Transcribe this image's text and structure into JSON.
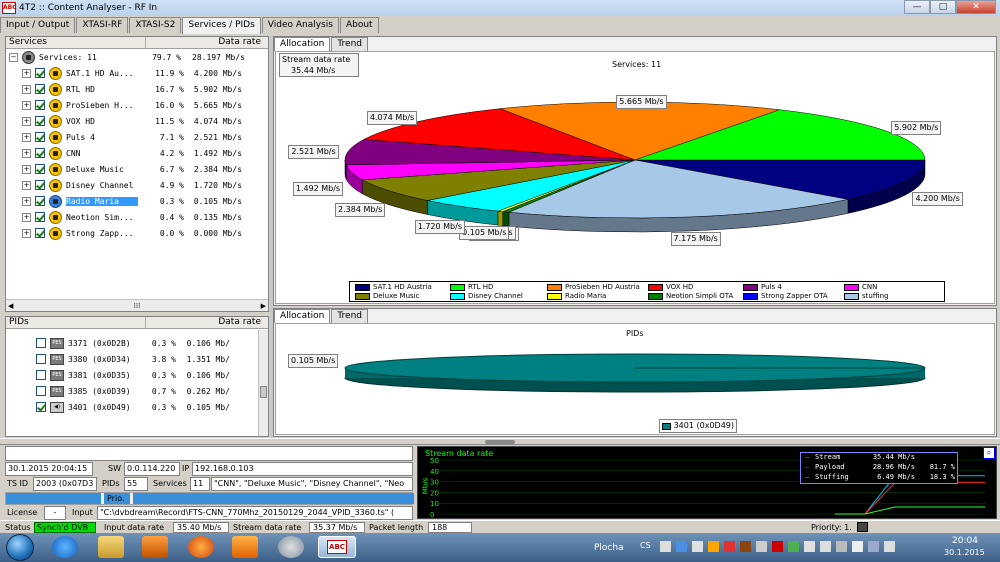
{
  "window": {
    "title": "4T2 :: Content Analyser - RF In",
    "app_badge": "ABC",
    "min": "—",
    "max": "□",
    "close": "✕"
  },
  "top_tabs": [
    "Input / Output",
    "XTASI-RF",
    "XTASI-S2",
    "Services / PIDs",
    "Video Analysis",
    "About"
  ],
  "services_panel": {
    "headers": [
      "Services",
      "Data rate"
    ],
    "root": {
      "label": "Services: 11",
      "pct": "79.7 %",
      "rate": "28.197 Mb/s"
    },
    "items": [
      {
        "name": "SAT.1 HD Au...",
        "pct": "11.9 %",
        "rate": "4.200 Mb/s"
      },
      {
        "name": "RTL HD",
        "pct": "16.7 %",
        "rate": "5.902 Mb/s"
      },
      {
        "name": "ProSieben H...",
        "pct": "16.0 %",
        "rate": "5.665 Mb/s"
      },
      {
        "name": "VOX HD",
        "pct": "11.5 %",
        "rate": "4.074 Mb/s"
      },
      {
        "name": "Puls 4",
        "pct": "7.1 %",
        "rate": "2.521 Mb/s"
      },
      {
        "name": "CNN",
        "pct": "4.2 %",
        "rate": "1.492 Mb/s"
      },
      {
        "name": "Deluxe Music",
        "pct": "6.7 %",
        "rate": "2.384 Mb/s"
      },
      {
        "name": "Disney Channel",
        "pct": "4.9 %",
        "rate": "1.720 Mb/s"
      },
      {
        "name": "Radio Maria",
        "pct": "0.3 %",
        "rate": "0.105 Mb/s",
        "selected": true
      },
      {
        "name": "Neotion Sim...",
        "pct": "0.4 %",
        "rate": "0.135 Mb/s"
      },
      {
        "name": "Strong Zapp...",
        "pct": "0.0 %",
        "rate": "0.000 Mb/s"
      }
    ]
  },
  "pids_panel": {
    "headers": [
      "PIDs",
      "Data rate"
    ],
    "items": [
      {
        "name": "3371 (0x0D2B)",
        "pct": "0.3 %",
        "rate": "0.106 Mb/",
        "checked": false
      },
      {
        "name": "3380 (0x0D34)",
        "pct": "3.8 %",
        "rate": "1.351 Mb/",
        "checked": false
      },
      {
        "name": "3381 (0x0D35)",
        "pct": "0.3 %",
        "rate": "0.106 Mb/",
        "checked": false
      },
      {
        "name": "3385 (0x0D39)",
        "pct": "0.7 %",
        "rate": "0.262 Mb/",
        "checked": false
      },
      {
        "name": "3401 (0x0D49)",
        "pct": "0.3 %",
        "rate": "0.105 Mb/",
        "checked": true
      }
    ],
    "pid_badge": "PES"
  },
  "chart_tabs": [
    "Allocation",
    "Trend"
  ],
  "stream_box": {
    "label": "Stream data rate",
    "value": "35.44 Mb/s"
  },
  "chart_data": [
    {
      "type": "pie",
      "title": "Services: 11",
      "unit": "Mb/s",
      "slices": [
        {
          "name": "SAT.1 HD Austria",
          "value": 4.2,
          "label": "4.200 Mb/s",
          "color": "#000080"
        },
        {
          "name": "stuffing",
          "value": 7.175,
          "label": "7.175 Mb/s",
          "color": "#a8c8e8"
        },
        {
          "name": "Strong Zapper OTA",
          "value": 0.0,
          "label": "0.000 Mb/s",
          "color": "#0000ff"
        },
        {
          "name": "Neotion Simpli OTA",
          "value": 0.135,
          "label": "0.135 Mb/s",
          "color": "#008000"
        },
        {
          "name": "Radio Maria",
          "value": 0.105,
          "label": "0.105 Mb/s",
          "color": "#ffff00"
        },
        {
          "name": "Disney Channel",
          "value": 1.72,
          "label": "1.720 Mb/s",
          "color": "#00ffff"
        },
        {
          "name": "Deluxe Music",
          "value": 2.384,
          "label": "2.384 Mb/s",
          "color": "#808000"
        },
        {
          "name": "CNN",
          "value": 1.492,
          "label": "1.492 Mb/s",
          "color": "#ff00ff"
        },
        {
          "name": "Puls 4",
          "value": 2.521,
          "label": "2.521 Mb/s",
          "color": "#800080"
        },
        {
          "name": "VOX HD",
          "value": 4.074,
          "label": "4.074 Mb/s",
          "color": "#ff0000"
        },
        {
          "name": "ProSieben HD Austria",
          "value": 5.665,
          "label": "5.665 Mb/s",
          "color": "#ff8000"
        },
        {
          "name": "RTL HD",
          "value": 5.902,
          "label": "5.902 Mb/s",
          "color": "#00ff00"
        }
      ],
      "legend": [
        "SAT.1 HD Austria",
        "RTL HD",
        "ProSieben HD Austria",
        "VOX HD",
        "Puls 4",
        "CNN",
        "Deluxe Music",
        "Disney Channel",
        "Radio Maria",
        "Neotion Simpli OTA",
        "Strong Zapper OTA",
        "stuffing"
      ]
    },
    {
      "type": "pie",
      "title": "PIDs",
      "unit": "Mb/s",
      "slices": [
        {
          "name": "3401 (0x0D49)",
          "value": 0.105,
          "label": "0.105 Mb/s",
          "color": "#008080"
        }
      ],
      "legend": [
        "3401 (0x0D49)"
      ]
    },
    {
      "type": "line",
      "title": "Stream data rate",
      "ylabel": "Mb/s",
      "yticks": [
        0,
        10,
        20,
        30,
        40,
        50
      ],
      "ylim": [
        0,
        50
      ],
      "series": [
        {
          "name": "Stream",
          "values": [
            0,
            0,
            35.44,
            35.44,
            35.44,
            35.44
          ],
          "color": "#00c0ff"
        },
        {
          "name": "Payload",
          "values": [
            0,
            0,
            28.96,
            28.96,
            28.96,
            28.96
          ],
          "color": "#ff3030"
        },
        {
          "name": "Stuffing",
          "values": [
            0,
            0,
            6.49,
            6.49,
            6.49,
            6.49
          ],
          "color": "#30ff30"
        }
      ],
      "readout": [
        {
          "name": "Stream",
          "value": "35.44 Mb/s",
          "pct": ""
        },
        {
          "name": "Payload",
          "value": "28.96 Mb/s",
          "pct": "81.7 %"
        },
        {
          "name": "Stuffing",
          "value": "6.49 Mb/s",
          "pct": "18.3 %"
        }
      ]
    }
  ],
  "info": {
    "datetime": "30.1.2015 20:04:15",
    "sw_label": "SW",
    "sw": "0.0.114.220",
    "ip_label": "IP",
    "ip": "192.168.0.103",
    "tsid_label": "TS ID",
    "tsid": "2003 (0x07D3",
    "pids_label": "PIDs",
    "pids": "55",
    "services_label": "Services",
    "services": "11",
    "services_list": "\"CNN\", \"Deluxe Music\", \"Disney Channel\", \"Neo",
    "prio": "Prio.",
    "license_label": "License",
    "license": "-",
    "input_label": "Input",
    "input": "\"C:\\dvbdream\\Record\\FTS-CNN_770Mhz_20150129_2044_VPID_3360.ts\" ("
  },
  "status": {
    "status_label": "Status",
    "status": "Synch'd DVB",
    "input_rate_label": "Input data rate",
    "input_rate": "35.40 Mb/s",
    "stream_rate_label": "Stream data rate",
    "stream_rate": "35.37 Mb/s",
    "packet_label": "Packet length",
    "packet": "188",
    "priority": "Priority: 1."
  },
  "taskbar": {
    "desktop": "Plocha",
    "lang": "CS",
    "time": "20:04",
    "date": "30.1.2015"
  }
}
